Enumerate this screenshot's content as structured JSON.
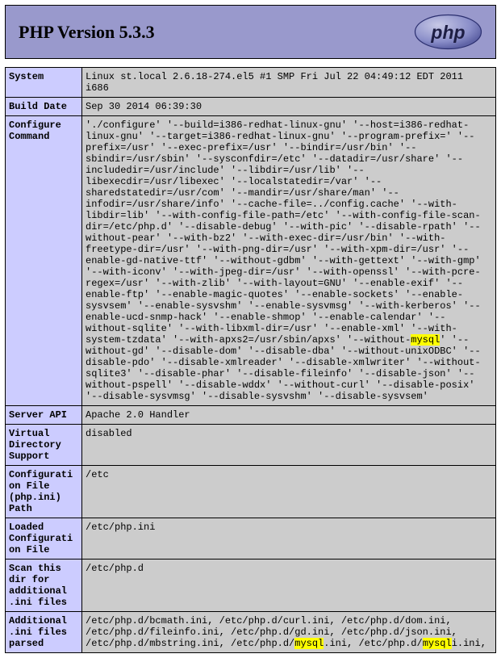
{
  "header": {
    "title": "PHP Version 5.3.3"
  },
  "rows": [
    {
      "label": "System",
      "value": "Linux st.local 2.6.18-274.el5 #1 SMP Fri Jul 22 04:49:12 EDT 2011 i686"
    },
    {
      "label": "Build Date",
      "value": "Sep 30 2014 06:39:30"
    },
    {
      "label": "Configure Command",
      "value": " './configure' '--build=i386-redhat-linux-gnu' '--host=i386-redhat-linux-gnu' '--target=i386-redhat-linux-gnu' '--program-prefix=' '--prefix=/usr' '--exec-prefix=/usr' '--bindir=/usr/bin' '--sbindir=/usr/sbin' '--sysconfdir=/etc' '--datadir=/usr/share' '--includedir=/usr/include' '--libdir=/usr/lib' '--libexecdir=/usr/libexec' '--localstatedir=/var' '--sharedstatedir=/usr/com' '--mandir=/usr/share/man' '--infodir=/usr/share/info' '--cache-file=../config.cache' '--with-libdir=lib' '--with-config-file-path=/etc' '--with-config-file-scan-dir=/etc/php.d' '--disable-debug' '--with-pic' '--disable-rpath' '--without-pear' '--with-bz2' '--with-exec-dir=/usr/bin' '--with-freetype-dir=/usr' '--with-png-dir=/usr' '--with-xpm-dir=/usr' '--enable-gd-native-ttf' '--without-gdbm' '--with-gettext' '--with-gmp' '--with-iconv' '--with-jpeg-dir=/usr' '--with-openssl' '--with-pcre-regex=/usr' '--with-zlib' '--with-layout=GNU' '--enable-exif' '--enable-ftp' '--enable-magic-quotes' '--enable-sockets' '--enable-sysvsem' '--enable-sysvshm' '--enable-sysvmsg' '--with-kerberos' '--enable-ucd-snmp-hack' '--enable-shmop' '--enable-calendar' '--without-sqlite' '--with-libxml-dir=/usr' '--enable-xml' '--with-system-tzdata' '--with-apxs2=/usr/sbin/apxs' '--without-mysql' '--without-gd' '--disable-dom' '--disable-dba' '--without-unixODBC' '--disable-pdo' '--disable-xmlreader' '--disable-xmlwriter' '--without-sqlite3' '--disable-phar' '--disable-fileinfo' '--disable-json' '--without-pspell' '--disable-wddx' '--without-curl' '--disable-posix' '--disable-sysvmsg' '--disable-sysvshm' '--disable-sysvsem'"
    },
    {
      "label": "Server API",
      "value": "Apache 2.0 Handler"
    },
    {
      "label": "Virtual Directory Support",
      "value": "disabled"
    },
    {
      "label": "Configuration File (php.ini) Path",
      "value": "/etc"
    },
    {
      "label": "Loaded Configuration File",
      "value": "/etc/php.ini"
    },
    {
      "label": "Scan this dir for additional .ini files",
      "value": "/etc/php.d"
    },
    {
      "label": "Additional .ini files parsed",
      "value": "/etc/php.d/bcmath.ini, /etc/php.d/curl.ini, /etc/php.d/dom.ini, /etc/php.d/fileinfo.ini, /etc/php.d/gd.ini, /etc/php.d/json.ini, /etc/php.d/mbstring.ini, /etc/php.d/mysql.ini, /etc/php.d/mysqli.ini,"
    }
  ],
  "highlights": [
    "mysql",
    "mysqli"
  ]
}
